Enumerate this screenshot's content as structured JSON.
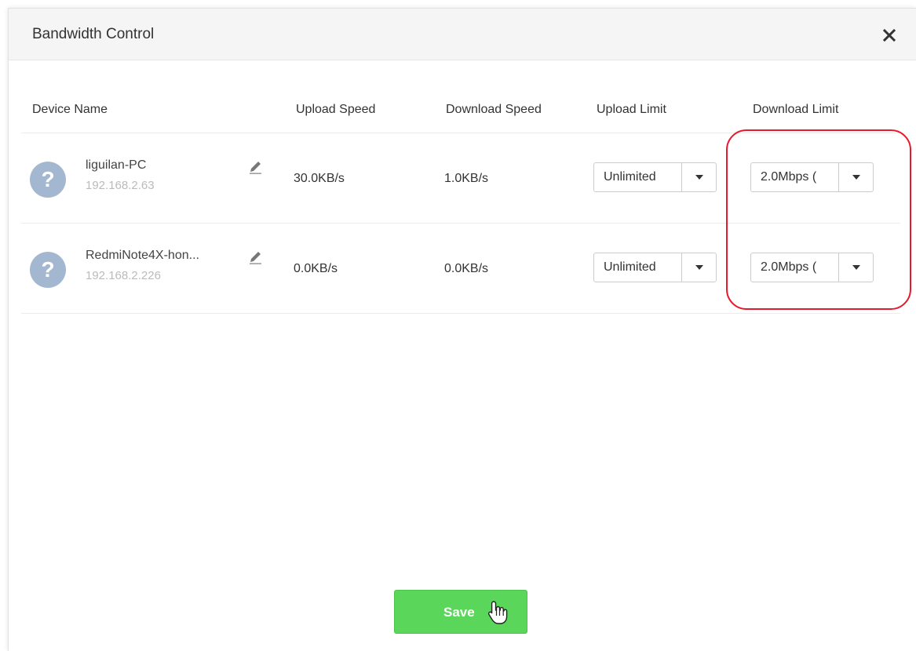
{
  "dialog": {
    "title": "Bandwidth Control"
  },
  "table": {
    "headers": {
      "device_name": "Device Name",
      "upload_speed": "Upload Speed",
      "download_speed": "Download Speed",
      "upload_limit": "Upload Limit",
      "download_limit": "Download Limit"
    },
    "rows": [
      {
        "name": "liguilan-PC",
        "ip": "192.168.2.63",
        "upload_speed": "30.0KB/s",
        "download_speed": "1.0KB/s",
        "upload_limit": "Unlimited",
        "download_limit": "2.0Mbps ("
      },
      {
        "name": "RedmiNote4X-hon...",
        "ip": "192.168.2.226",
        "upload_speed": "0.0KB/s",
        "download_speed": "0.0KB/s",
        "upload_limit": "Unlimited",
        "download_limit": "2.0Mbps ("
      }
    ]
  },
  "avatar_glyph": "?",
  "icons": {
    "close": "close-icon",
    "edit": "pencil-icon",
    "caret": "caret-down-icon",
    "cursor": "hand-pointer-icon"
  },
  "footer": {
    "save_label": "Save"
  },
  "colors": {
    "save_button": "#5ad65a",
    "highlight": "#e8192c",
    "avatar": "#a3b8d0"
  }
}
